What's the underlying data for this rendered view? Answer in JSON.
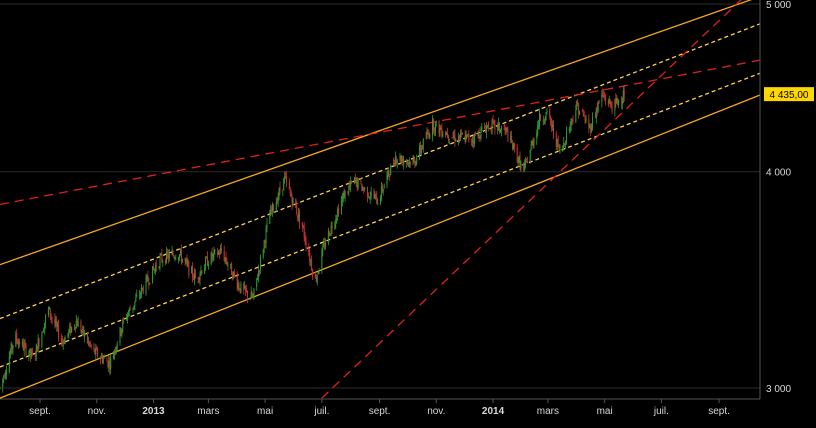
{
  "chart_data": {
    "type": "candlestick",
    "y_scale": "log",
    "ylim": [
      2960,
      5040
    ],
    "y_ticks": [
      {
        "value": 3000,
        "label": "3 000"
      },
      {
        "value": 4000,
        "label": "4 000"
      },
      {
        "value": 5000,
        "label": "5 000"
      }
    ],
    "x_ticks": [
      {
        "date": "2012-09-01",
        "label": "sept.",
        "bold": false
      },
      {
        "date": "2012-11-01",
        "label": "nov.",
        "bold": false
      },
      {
        "date": "2013-01-01",
        "label": "2013",
        "bold": true
      },
      {
        "date": "2013-03-01",
        "label": "mars",
        "bold": false
      },
      {
        "date": "2013-05-01",
        "label": "mai",
        "bold": false
      },
      {
        "date": "2013-07-01",
        "label": "juil.",
        "bold": false
      },
      {
        "date": "2013-09-01",
        "label": "sept.",
        "bold": false
      },
      {
        "date": "2013-11-01",
        "label": "nov.",
        "bold": false
      },
      {
        "date": "2014-01-01",
        "label": "2014",
        "bold": true
      },
      {
        "date": "2014-03-01",
        "label": "mars",
        "bold": false
      },
      {
        "date": "2014-05-01",
        "label": "mai",
        "bold": false
      },
      {
        "date": "2014-07-01",
        "label": "juil.",
        "bold": false
      },
      {
        "date": "2014-09-01",
        "label": "sept.",
        "bold": false
      }
    ],
    "xlim": [
      "2012-07-20",
      "2014-10-15"
    ],
    "last_price": {
      "value": 4435,
      "label": "4 435,00"
    },
    "grid": {
      "horizontal": true,
      "vertical": false
    },
    "colors": {
      "background": "#000000",
      "up_candle": "#2e9e2e",
      "down_candle": "#cc3333",
      "channel_solid": "#f5a623",
      "channel_dashed": "#ffd24d",
      "resistance": "#e02020",
      "price_label_bg": "#ffd700",
      "gridline": "#2b2b2b"
    },
    "price_path": [
      {
        "date": "2012-07-20",
        "price": 3000
      },
      {
        "date": "2012-08-05",
        "price": 3210
      },
      {
        "date": "2012-08-25",
        "price": 3120
      },
      {
        "date": "2012-09-10",
        "price": 3330
      },
      {
        "date": "2012-09-25",
        "price": 3190
      },
      {
        "date": "2012-10-10",
        "price": 3280
      },
      {
        "date": "2012-10-28",
        "price": 3150
      },
      {
        "date": "2012-11-15",
        "price": 3100
      },
      {
        "date": "2012-12-01",
        "price": 3290
      },
      {
        "date": "2012-12-20",
        "price": 3420
      },
      {
        "date": "2013-01-08",
        "price": 3560
      },
      {
        "date": "2013-01-28",
        "price": 3590
      },
      {
        "date": "2013-02-15",
        "price": 3470
      },
      {
        "date": "2013-03-01",
        "price": 3560
      },
      {
        "date": "2013-03-15",
        "price": 3600
      },
      {
        "date": "2013-04-05",
        "price": 3420
      },
      {
        "date": "2013-04-18",
        "price": 3380
      },
      {
        "date": "2013-05-05",
        "price": 3760
      },
      {
        "date": "2013-05-22",
        "price": 3960
      },
      {
        "date": "2013-06-10",
        "price": 3720
      },
      {
        "date": "2013-06-24",
        "price": 3460
      },
      {
        "date": "2013-07-05",
        "price": 3650
      },
      {
        "date": "2013-07-25",
        "price": 3880
      },
      {
        "date": "2013-08-05",
        "price": 3950
      },
      {
        "date": "2013-08-30",
        "price": 3850
      },
      {
        "date": "2013-09-18",
        "price": 4080
      },
      {
        "date": "2013-10-08",
        "price": 4050
      },
      {
        "date": "2013-10-28",
        "price": 4260
      },
      {
        "date": "2013-11-20",
        "price": 4190
      },
      {
        "date": "2013-12-10",
        "price": 4180
      },
      {
        "date": "2013-12-28",
        "price": 4260
      },
      {
        "date": "2014-01-15",
        "price": 4220
      },
      {
        "date": "2014-02-03",
        "price": 4000
      },
      {
        "date": "2014-02-20",
        "price": 4290
      },
      {
        "date": "2014-03-01",
        "price": 4320
      },
      {
        "date": "2014-03-14",
        "price": 4100
      },
      {
        "date": "2014-04-01",
        "price": 4370
      },
      {
        "date": "2014-04-15",
        "price": 4240
      },
      {
        "date": "2014-04-28",
        "price": 4430
      },
      {
        "date": "2014-05-10",
        "price": 4360
      },
      {
        "date": "2014-05-22",
        "price": 4435
      }
    ],
    "trendlines": [
      {
        "name": "channel-upper",
        "style": "solid",
        "color": "#f5a623",
        "points": [
          {
            "date": "2012-07-20",
            "price": 3535
          },
          {
            "date": "2014-10-15",
            "price": 5050
          }
        ]
      },
      {
        "name": "channel-upper-inner",
        "style": "dotted",
        "color": "#ffd24d",
        "points": [
          {
            "date": "2012-07-20",
            "price": 3290
          },
          {
            "date": "2014-10-15",
            "price": 4870
          }
        ]
      },
      {
        "name": "channel-lower-inner",
        "style": "dotted",
        "color": "#ffd24d",
        "points": [
          {
            "date": "2012-07-20",
            "price": 3085
          },
          {
            "date": "2014-10-15",
            "price": 4560
          }
        ]
      },
      {
        "name": "channel-lower",
        "style": "solid",
        "color": "#f5a623",
        "points": [
          {
            "date": "2012-07-20",
            "price": 2960
          },
          {
            "date": "2014-10-15",
            "price": 4430
          }
        ]
      },
      {
        "name": "resistance-long",
        "style": "dashed",
        "color": "#e02020",
        "points": [
          {
            "date": "2012-07-20",
            "price": 3830
          },
          {
            "date": "2014-10-15",
            "price": 4640
          }
        ]
      },
      {
        "name": "support-steep",
        "style": "dashed",
        "color": "#e02020",
        "points": [
          {
            "date": "2013-07-01",
            "price": 2960
          },
          {
            "date": "2014-10-15",
            "price": 5150
          }
        ]
      }
    ]
  }
}
